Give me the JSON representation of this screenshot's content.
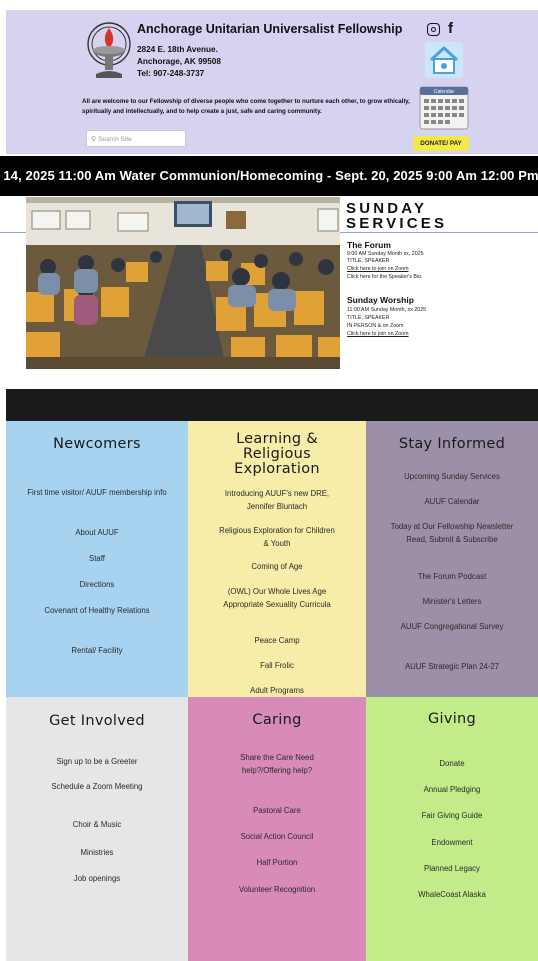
{
  "header": {
    "org_name": "Anchorage Unitarian Universalist Fellowship",
    "address_1": "2824 E. 18th Avenue.",
    "address_2": "Anchorage, AK  99508",
    "phone": "Tel: 907-248-3737",
    "welcome": "All are welcome to our Fellowship of diverse people who come together to nurture each other, to grow ethically, spiritually and intellectually, and to help create a just, safe and caring community.",
    "search_placeholder": "Search Site",
    "donate_label": "DONATE/ PAY",
    "calendar_label": "Calendar",
    "social_icons": [
      "instagram-icon",
      "facebook-icon"
    ],
    "colors": {
      "header_bg": "#d6d3f0",
      "donate_bg": "#f5e94a"
    }
  },
  "ticker": {
    "text": ". 14, 2025 11:00 Am Water Communion/Homecoming - Sept. 20, 2025 9:00 Am 12:00 Pm I"
  },
  "services": {
    "title_1": "SUNDAY",
    "title_2": "SERVICES",
    "forum": {
      "heading": "The Forum",
      "line_1": "9:00 AM Sunday Month xx, 2025",
      "line_2": "TITLE, SPEAKER",
      "line_3": "Click here to join on Zoom",
      "line_4": "Click here for the Speaker's Bio."
    },
    "worship": {
      "heading": "Sunday Worship",
      "line_1": "11:00 AM Sunday Month, xx 2025",
      "line_2": "TITLE, SPEAKER",
      "line_3": "IN PERSON & on Zoom",
      "line_4": "Click here to join on Zoom"
    }
  },
  "sections": {
    "newcomers": {
      "title": "Newcomers",
      "color": "#a8d3f0",
      "items": [
        "First time visitor/ AUUF membership info",
        "About AUUF",
        "Staff",
        "Directions",
        "Covenant of Healthy Relations",
        "Rental/ Facility"
      ]
    },
    "learning": {
      "title": "Learning & Religious Exploration",
      "color": "#f7eda8",
      "items": [
        "Introducing AUUF's new DRE, Jennifer Bluntach",
        "Religious Exploration for Children & Youth",
        "Coming of Age",
        "(OWL) Our Whole Lives Age Appropriate Sexuality Curricula",
        "Peace Camp",
        "Fall Frolic",
        "Adult Programs"
      ]
    },
    "informed": {
      "title": "Stay Informed",
      "color": "#9c90a8",
      "items": [
        "Upcoming Sunday Services",
        "AUUF Calendar",
        "Today at Our Fellowship Newsletter Read, Submit & Subscribe",
        "The Forum Podcast",
        "Minister's Letters",
        "AUUF Congregational Survey",
        "AUUF Strategic Plan 24-27"
      ]
    },
    "involved": {
      "title": "Get Involved",
      "color": "#e6e6e6",
      "items": [
        "Sign up to be a Greeter",
        "Schedule a Zoom Meeting",
        "Choir & Music",
        "Ministries",
        "Job openings"
      ]
    },
    "caring": {
      "title": "Caring",
      "color": "#d88ab8",
      "items": [
        "Share the Care Need help?/Offering help?",
        "Pastoral Care",
        "Social Action Council",
        "Half Portion",
        "Volunteer Recognition"
      ]
    },
    "giving": {
      "title": "Giving",
      "color": "#c2ec8a",
      "items": [
        "Donate",
        "Annual Pledging",
        "Fair Giving Guide",
        "Endowment",
        "Planned Legacy",
        "WhaleCoast Alaska"
      ]
    }
  }
}
